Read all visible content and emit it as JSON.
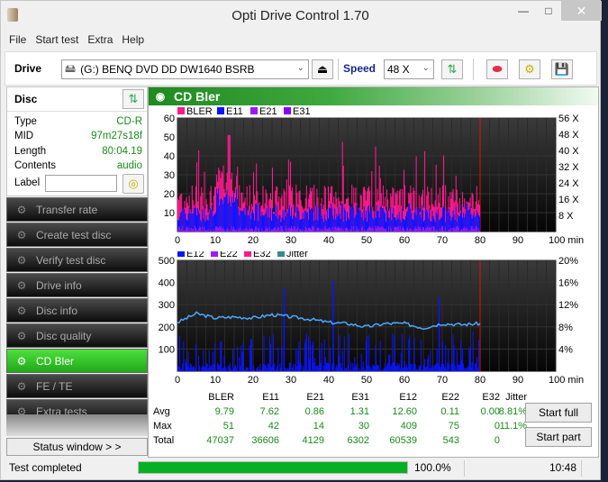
{
  "window": {
    "title": "Opti Drive Control 1.70"
  },
  "menu": [
    "File",
    "Start test",
    "Extra",
    "Help"
  ],
  "toolbar": {
    "drive_label": "Drive",
    "drive_value": "(G:)  BENQ DVD DD DW1640 BSRB",
    "speed_label": "Speed",
    "speed_value": "48 X"
  },
  "disc": {
    "heading": "Disc",
    "rows": [
      {
        "k": "Type",
        "v": "CD-R"
      },
      {
        "k": "MID",
        "v": "97m27s18f"
      },
      {
        "k": "Length",
        "v": "80:04.19"
      },
      {
        "k": "Contents",
        "v": "audio"
      }
    ],
    "label_key": "Label",
    "label_value": ""
  },
  "nav": [
    {
      "label": "Transfer rate",
      "active": false
    },
    {
      "label": "Create test disc",
      "active": false
    },
    {
      "label": "Verify test disc",
      "active": false
    },
    {
      "label": "Drive info",
      "active": false
    },
    {
      "label": "Disc info",
      "active": false
    },
    {
      "label": "Disc quality",
      "active": false
    },
    {
      "label": "CD Bler",
      "active": true
    },
    {
      "label": "FE / TE",
      "active": false
    },
    {
      "label": "Extra tests",
      "active": false
    }
  ],
  "status_window_btn": "Status window > >",
  "panel": {
    "title": "CD Bler"
  },
  "chart_data": [
    {
      "type": "bar",
      "title": "",
      "legend": [
        {
          "name": "BLER",
          "color": "#ff1a8c"
        },
        {
          "name": "E11",
          "color": "#0a14ff"
        },
        {
          "name": "E21",
          "color": "#9a1aff"
        },
        {
          "name": "E31",
          "color": "#8a00ff"
        }
      ],
      "x_ticks": [
        "0",
        "10",
        "20",
        "30",
        "40",
        "50",
        "60",
        "70",
        "80",
        "90",
        "100 min"
      ],
      "y_ticks_left": [
        "10",
        "20",
        "30",
        "40",
        "50",
        "60"
      ],
      "y_ticks_right": [
        "8 X",
        "16 X",
        "24 X",
        "32 X",
        "40 X",
        "48 X",
        "56 X"
      ],
      "xlim": [
        0,
        100
      ],
      "ylim": [
        0,
        60
      ],
      "end_marker": 80,
      "summary": {
        "BLER_max": 51,
        "E11_max": 42,
        "typical_BLER": [
          10,
          25
        ],
        "typical_E11": [
          5,
          15
        ]
      }
    },
    {
      "type": "bar",
      "title": "",
      "legend": [
        {
          "name": "E12",
          "color": "#0a14ff"
        },
        {
          "name": "E22",
          "color": "#9a1aff"
        },
        {
          "name": "E32",
          "color": "#ff1a8c"
        },
        {
          "name": "Jitter",
          "color": "#3a8a8a"
        }
      ],
      "x_ticks": [
        "0",
        "10",
        "20",
        "30",
        "40",
        "50",
        "60",
        "70",
        "80",
        "90",
        "100 min"
      ],
      "y_ticks_left": [
        "100",
        "200",
        "300",
        "400",
        "500"
      ],
      "y_ticks_right": [
        "4%",
        "8%",
        "12%",
        "16%",
        "20%"
      ],
      "xlim": [
        0,
        100
      ],
      "ylim": [
        0,
        500
      ],
      "end_marker": 80,
      "jitter_series": {
        "x": [
          0,
          5,
          10,
          15,
          20,
          25,
          30,
          35,
          40,
          45,
          50,
          55,
          60,
          65,
          70,
          75,
          80
        ],
        "y_pct": [
          8.8,
          10.4,
          9.6,
          9.8,
          9.6,
          10.2,
          9.8,
          9.4,
          8.8,
          8.6,
          8.0,
          8.6,
          8.6,
          7.8,
          8.6,
          8.4,
          8.6
        ]
      },
      "spikes": [
        {
          "x": 28,
          "y": 375
        },
        {
          "x": 41,
          "y": 409
        },
        {
          "x": 69,
          "y": 335
        }
      ]
    }
  ],
  "stats": {
    "headers": [
      "BLER",
      "E11",
      "E21",
      "E31",
      "E12",
      "E22",
      "E32",
      "Jitter"
    ],
    "rows": [
      {
        "label": "Avg",
        "values": [
          "9.79",
          "7.62",
          "0.86",
          "1.31",
          "12.60",
          "0.11",
          "0.00",
          "8.81%"
        ]
      },
      {
        "label": "Max",
        "values": [
          "51",
          "42",
          "14",
          "30",
          "409",
          "75",
          "0",
          "11.1%"
        ]
      },
      {
        "label": "Total",
        "values": [
          "47037",
          "36606",
          "4129",
          "6302",
          "60539",
          "543",
          "0",
          ""
        ]
      }
    ]
  },
  "buttons": {
    "start_full": "Start full",
    "start_part": "Start part"
  },
  "statusbar": {
    "text": "Test completed",
    "progress_pct": 100,
    "progress_text": "100.0%",
    "time": "10:48"
  }
}
